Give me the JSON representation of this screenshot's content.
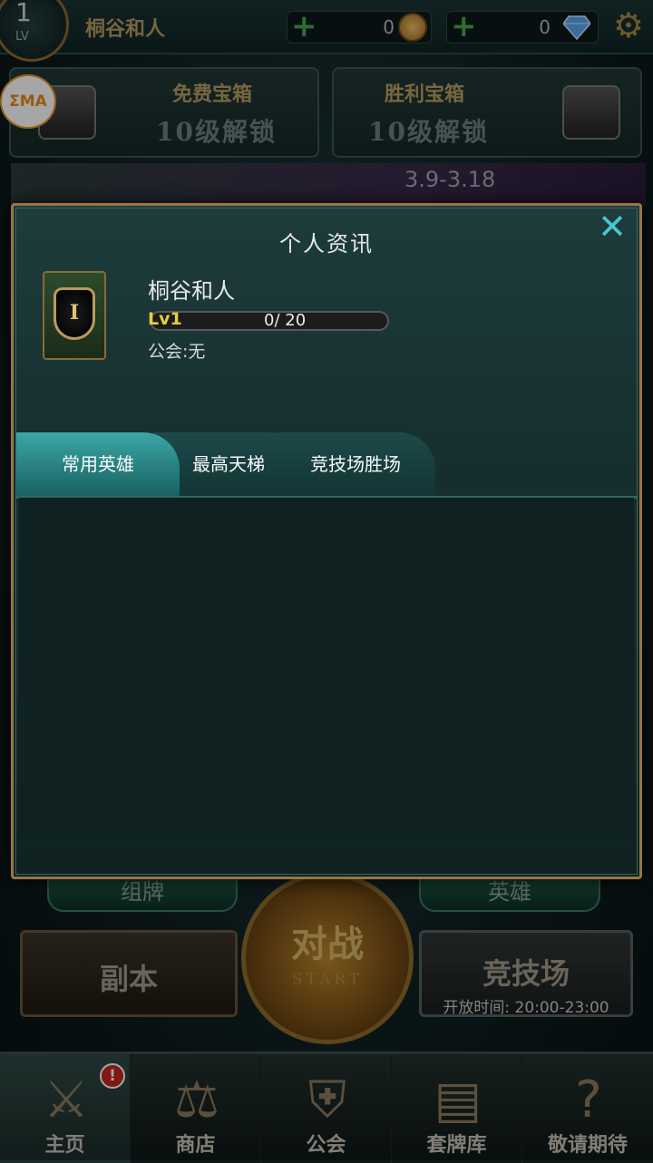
{
  "top": {
    "level": "1",
    "level_label": "LV",
    "player_name": "桐谷和人",
    "gold": "0",
    "gems": "0"
  },
  "chests": [
    {
      "title": "免费宝箱",
      "status": "10级解锁"
    },
    {
      "title": "胜利宝箱",
      "status": "10级解锁"
    }
  ],
  "watermark": "ΣMA",
  "event_banner": {
    "date_range": "3.9-3.18"
  },
  "lobby": {
    "deck_label": "组牌",
    "heroes_label": "英雄",
    "dungeon_label": "副本",
    "battle_label": "对战",
    "battle_sub": "START",
    "arena_label": "竞技场",
    "arena_hours": "开放时间: 20:00-23:00"
  },
  "nav": {
    "items": [
      {
        "label": "主页",
        "icon": "crossed-swords-icon",
        "badge": "!"
      },
      {
        "label": "商店",
        "icon": "scales-icon"
      },
      {
        "label": "公会",
        "icon": "guild-emblem-icon"
      },
      {
        "label": "套牌库",
        "icon": "cards-icon"
      },
      {
        "label": "敬请期待",
        "icon": "question-icon"
      }
    ]
  },
  "modal": {
    "title": "个人资讯",
    "player": {
      "name": "桐谷和人",
      "rank_numeral": "I",
      "level_label": "Lv1",
      "xp_progress": "0/ 20",
      "xp_fraction": 0,
      "guild": "公会:无"
    },
    "tabs": [
      {
        "label": "常用英雄",
        "active": true
      },
      {
        "label": "最高天梯",
        "active": false
      },
      {
        "label": "竞技场胜场",
        "active": false
      }
    ]
  },
  "colors": {
    "accent_teal": "#3ca6a6",
    "gold_border": "#9a7440",
    "close_icon": "#49c6cf",
    "level_yellow": "#e4d03a"
  }
}
